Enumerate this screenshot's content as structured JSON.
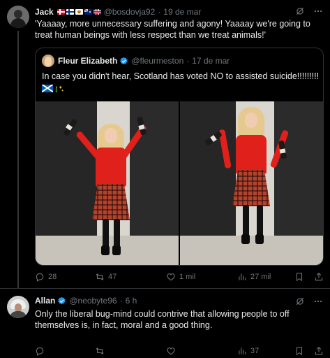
{
  "tweet1": {
    "author_name": "Jack",
    "flags": [
      "denmark-flag",
      "finland-flag",
      "cyprus-flag",
      "australia-flag",
      "uk-flag"
    ],
    "handle": "@bosdovja92",
    "separator": "·",
    "time": "19 de mar",
    "text": "'Yaaaay, more unnecessary suffering and agony! Yaaaay we're going to treat human beings with less respect than we treat animals!'",
    "quoted": {
      "author_name": "Fleur Elizabeth",
      "verified": true,
      "handle": "@fleurmeston",
      "separator": "·",
      "time": "17 de mar",
      "text": "In case you didn't hear, Scotland has voted NO to assisted suicide!!!!!!!!!",
      "emojis": [
        "scotland-flag",
        "sparkles-bottle"
      ],
      "photos": [
        {
          "alt": "woman holding two bottles in front of dark doors"
        },
        {
          "alt": "woman holding two bottles in front of dark doors"
        }
      ]
    },
    "actions": {
      "replies": "28",
      "reposts": "47",
      "likes": "1 mil",
      "views": "27 mil"
    }
  },
  "tweet2": {
    "author_name": "Allan",
    "verified": true,
    "handle": "@neobyte96",
    "separator": "·",
    "time": "6 h",
    "text": "Only the liberal bug-mind could contrive that allowing people to off themselves is, in fact, moral and a good thing.",
    "actions": {
      "replies": "",
      "reposts": "",
      "likes": "",
      "views": "37"
    }
  },
  "colors": {
    "background": "#000000",
    "text": "#e7e9ea",
    "muted": "#71767b",
    "border": "#2f3336",
    "verified": "#1d9bf0"
  }
}
